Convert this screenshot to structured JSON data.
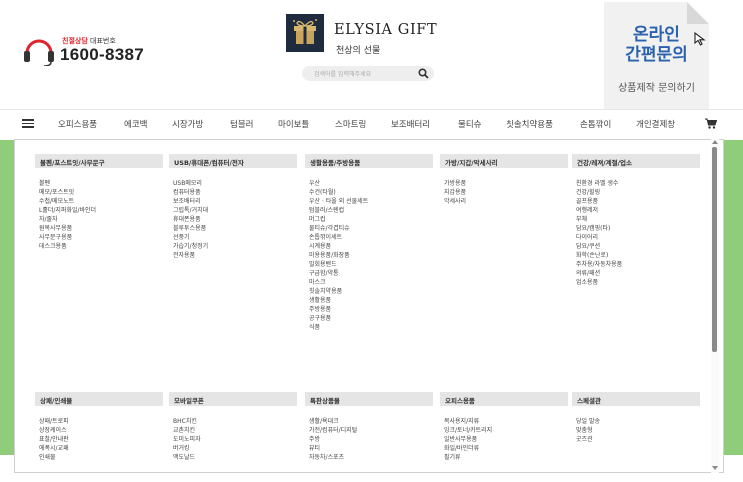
{
  "header": {
    "cs_label_highlight": "친절상담",
    "cs_label_rest": "대표번호",
    "cs_phone": "1600-8387",
    "logo_en": "ELYSIA GIFT",
    "logo_ko": "천상의 선물",
    "search_placeholder": "검색어를 입력해주세요",
    "banner_line1": "온라인",
    "banner_line2": "간편문의",
    "banner_line3": "상품제작 문의하기",
    "colors": {
      "banner_text": "#2c62ad",
      "highlight": "#e0242b",
      "logo_bg": "#1f2b3e"
    }
  },
  "nav": {
    "items": [
      "오피스용품",
      "에코백",
      "시장가방",
      "텀블러",
      "마이보틀",
      "스마트링",
      "보조배터리",
      "물티슈",
      "칫솔치약용품",
      "손톱깎이",
      "개인결제창"
    ]
  },
  "mega_menu": {
    "columns": [
      {
        "title": "볼펜/포스트잇/사무문구",
        "items": [
          "볼펜",
          "메모/포스트잇",
          "수첩/메모노트",
          "L홀더/지퍼화일/바인더",
          "자/줄자",
          "원목사무용품",
          "사무문구용품",
          "데스크용품"
        ]
      },
      {
        "title": "USB/휴대폰/컴퓨터/전자",
        "items": [
          "USB메모리",
          "컴퓨터용품",
          "보조배터리",
          "그립톡/거치대",
          "휴대폰용품",
          "블루투스용품",
          "선풍기",
          "가습기/청정기",
          "전자용품"
        ]
      },
      {
        "title": "생활용품/주방용품",
        "items": [
          "우산",
          "수건(타월)",
          "우산 · 타올 외 선물세트",
          "텀블러/스텐컵",
          "머그컵",
          "물티슈/각겹티슈",
          "손톱깎이세트",
          "시계용품",
          "미용용품/화장품",
          "밀회용밴드",
          "구급함/약통",
          "마스크",
          "칫솔치약용품",
          "생활용품",
          "주방용품",
          "공구용품",
          "식품"
        ]
      },
      {
        "title": "가방/지갑/악세사리",
        "items": [
          "가방용품",
          "지갑용품",
          "악세사리"
        ]
      },
      {
        "title": "건강/레져/계절/업소",
        "items": [
          "친환경 라벨 생수",
          "건강/힐링",
          "골프용품",
          "여행레저",
          "부채",
          "담요/캠핑(타)",
          "다이어리",
          "담요/쿠션",
          "화학(손난로)",
          "주차용/자동차용품",
          "의류/패션",
          "업소용품"
        ]
      },
      {
        "title": "상패/인쇄물",
        "items": [
          "상패/트로피",
          "상장케이스",
          "표찰/안내판",
          "에폭시/교패",
          "인쇄물"
        ]
      },
      {
        "title": "모바일쿠폰",
        "items": [
          "BHC치킨",
          "교촌치킨",
          "도미노피자",
          "버거킹",
          "맥도날드"
        ]
      },
      {
        "title": "특판상품몰",
        "items": [
          "생활/욕대크",
          "가전/컴퓨터/디지털",
          "주방",
          "뷰티",
          "자동차/스포츠"
        ]
      },
      {
        "title": "오피스용품",
        "items": [
          "복사용지/지류",
          "잉크/토너/카트리지",
          "일반사무용품",
          "화일/바인더류",
          "필기류"
        ]
      },
      {
        "title": "스페셜관",
        "items": [
          "당일 발송",
          "맞춤형",
          "굿즈관"
        ]
      }
    ]
  }
}
